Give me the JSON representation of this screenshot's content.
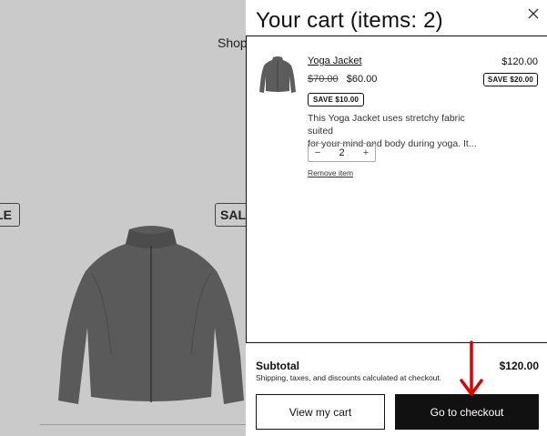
{
  "background": {
    "nav_text": "Shop",
    "badge_left": "LE",
    "badge_right": "SAL"
  },
  "cart": {
    "title": "Your cart (items: 2)",
    "items": [
      {
        "name": "Yoga Jacket",
        "total_price": "$120.00",
        "original_price": "$70.00",
        "sale_price": "$60.00",
        "line_savings": "SAVE $20.00",
        "item_savings": "SAVE $10.00",
        "description_line1": "This Yoga Jacket uses stretchy fabric suited",
        "description_line2": "for your mind and body during yoga. It...",
        "quantity": "2",
        "remove_label": "Remove item"
      }
    ],
    "subtotal_label": "Subtotal",
    "subtotal_value": "$120.00",
    "subtotal_note": "Shipping, taxes, and discounts calculated at checkout.",
    "view_cart_label": "View my cart",
    "checkout_label": "Go to checkout"
  },
  "icons": {
    "close": "close-icon",
    "minus": "minus-icon",
    "plus": "plus-icon",
    "annotation": "red-arrow-down-icon"
  },
  "colors": {
    "backdrop": "#cacaca",
    "primary_button": "#111111",
    "annotation": "#e00000"
  }
}
